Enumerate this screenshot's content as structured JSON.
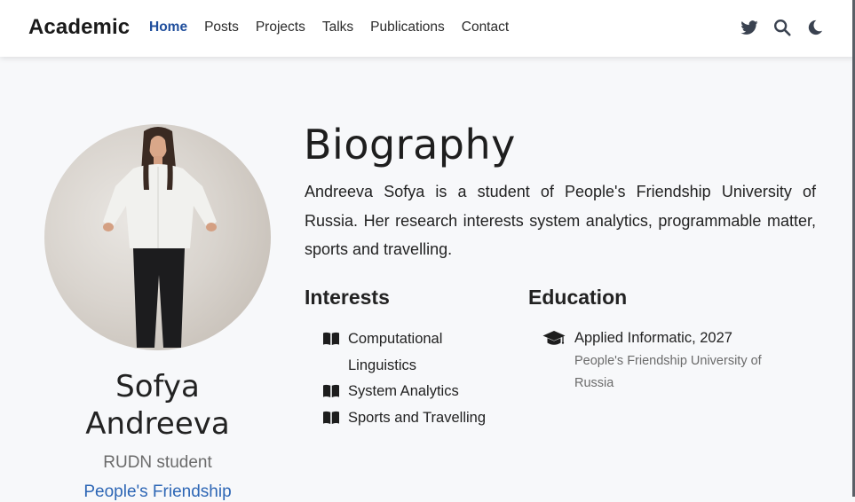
{
  "navbar": {
    "brand": "Academic",
    "links": [
      {
        "label": "Home",
        "active": true
      },
      {
        "label": "Posts",
        "active": false
      },
      {
        "label": "Projects",
        "active": false
      },
      {
        "label": "Talks",
        "active": false
      },
      {
        "label": "Publications",
        "active": false
      },
      {
        "label": "Contact",
        "active": false
      }
    ],
    "icons": [
      "twitter-icon",
      "search-icon",
      "moon-icon"
    ]
  },
  "profile": {
    "name": "Sofya Andreeva",
    "role": "RUDN student",
    "organization": "People's Friendship"
  },
  "biography": {
    "title": "Biography",
    "text": "Andreeva Sofya is a student of People's Friendship University of Russia. Her research interests system analytics, programmable matter, sports and travelling."
  },
  "interests": {
    "title": "Interests",
    "items": [
      "Computational Linguistics",
      "System Analytics",
      "Sports and Travelling"
    ]
  },
  "education": {
    "title": "Education",
    "items": [
      {
        "course": "Applied Informatic, 2027",
        "institution": "People's Friendship University of Russia"
      }
    ]
  },
  "colors": {
    "accent": "#1f4e9c",
    "link": "#2d66b5",
    "muted_text": "#6b6b6b",
    "background": "#f7f8fa"
  }
}
